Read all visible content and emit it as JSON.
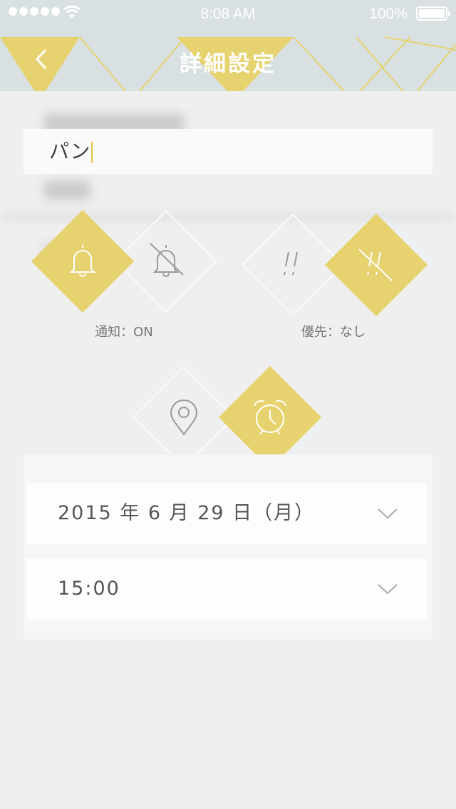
{
  "status_bar": {
    "time": "8:08 AM",
    "battery": "100%"
  },
  "nav": {
    "title": "詳細設定",
    "back_icon": "chevron-left-icon"
  },
  "task": {
    "name_value": "パン"
  },
  "toggles": {
    "notification_caption": "通知：ON",
    "priority_caption": "優先：なし"
  },
  "reminder": {
    "date_value": "2015 年  6 月 29 日（月）",
    "time_value": "15:00"
  },
  "colors": {
    "accent": "#e6d26e",
    "navbar": "#d9e0e2",
    "background": "#efefef"
  }
}
